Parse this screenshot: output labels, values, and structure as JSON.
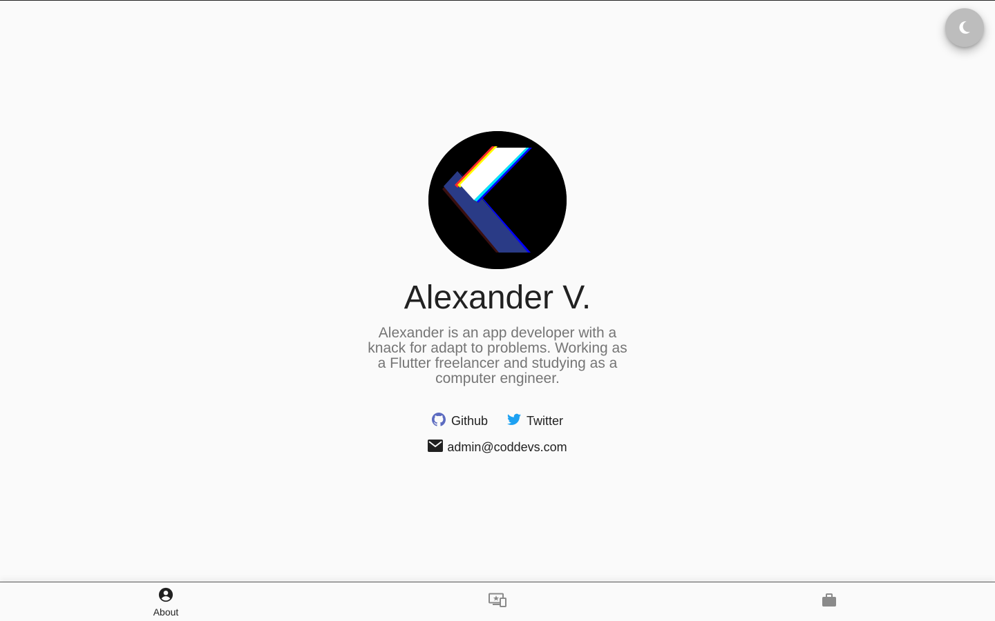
{
  "theme_toggle": {
    "icon": "moon-icon"
  },
  "profile": {
    "name": "Alexander V.",
    "bio": "Alexander is an app developer with a knack for adapt to problems. Working as a Flutter freelancer and studying as a computer engineer."
  },
  "links": {
    "github": {
      "label": "Github",
      "icon": "github-icon"
    },
    "twitter": {
      "label": "Twitter",
      "icon": "twitter-icon"
    },
    "email": {
      "label": "admin@coddevs.com",
      "icon": "mail-icon"
    }
  },
  "bottom_nav": {
    "items": [
      {
        "label": "About",
        "icon": "account-circle-icon",
        "active": true
      },
      {
        "label": "",
        "icon": "featured-devices-icon",
        "active": false
      },
      {
        "label": "",
        "icon": "briefcase-icon",
        "active": false
      }
    ]
  },
  "colors": {
    "background": "#fafafa",
    "text_primary": "#212121",
    "text_secondary": "#757575",
    "github": "#5c6bc0",
    "twitter": "#1da1f2",
    "toggle": "#bdbdbd",
    "nav_inactive": "#8a8a8a"
  }
}
